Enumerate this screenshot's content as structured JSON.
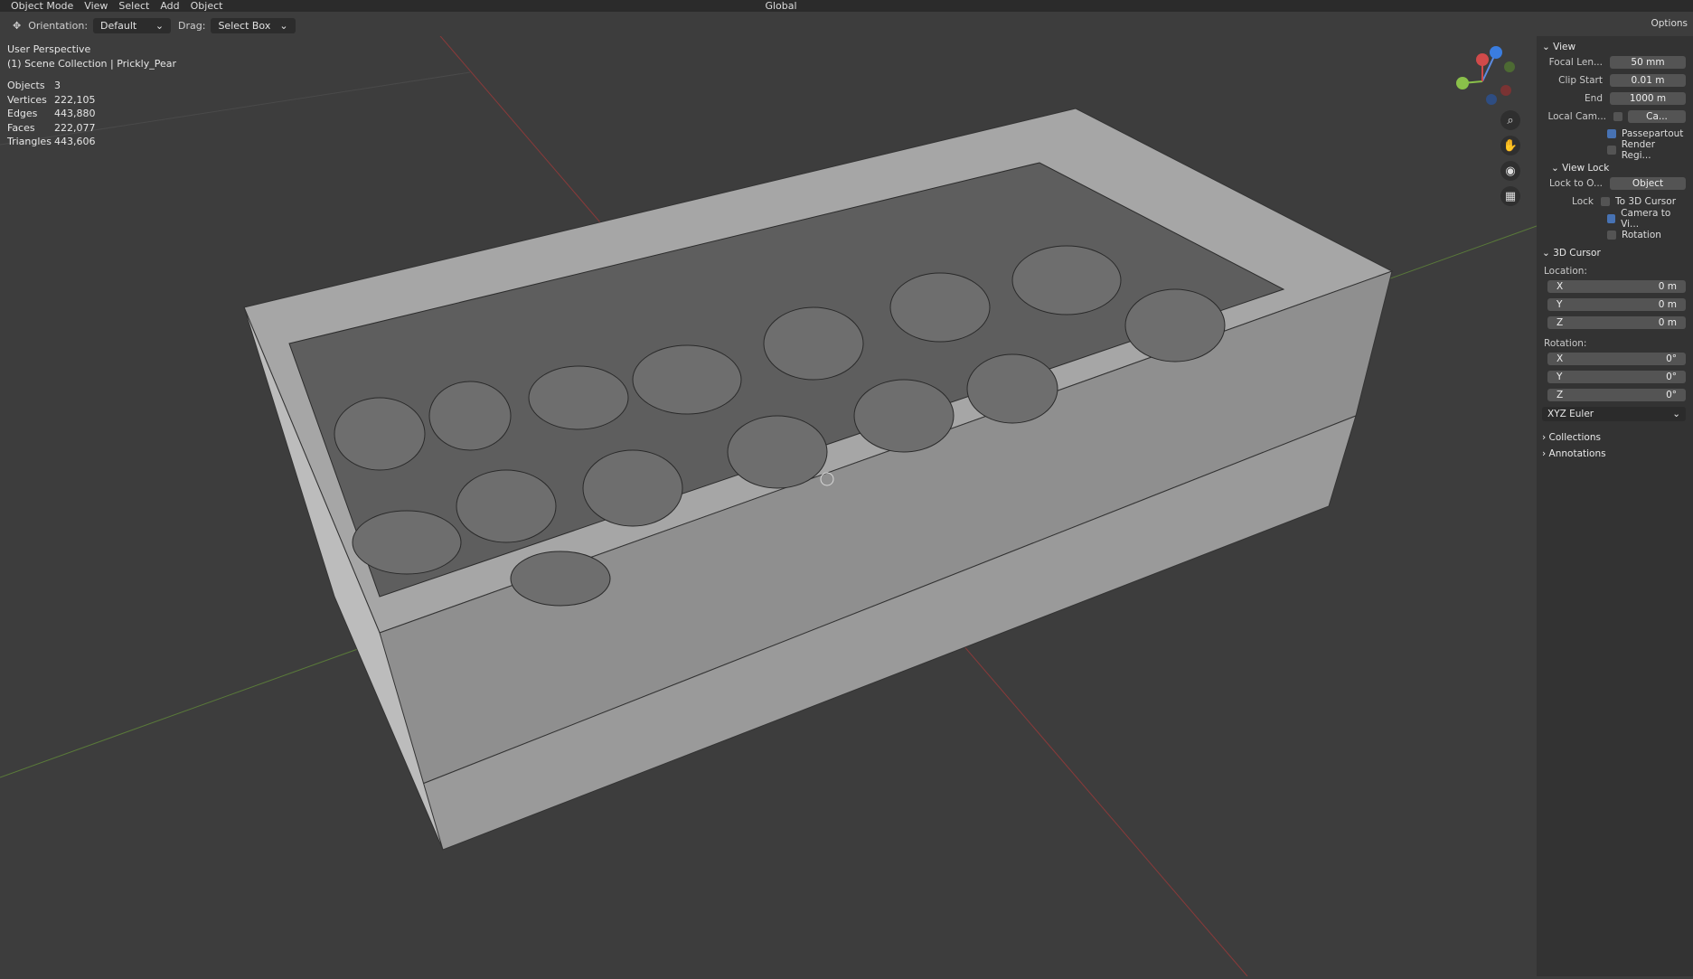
{
  "topbar": {
    "mode": "Object Mode",
    "menu": [
      "View",
      "Select",
      "Add",
      "Object"
    ],
    "transform": "Global"
  },
  "toolbar": {
    "orientation_label": "Orientation:",
    "orientation_value": "Default",
    "drag_label": "Drag:",
    "drag_value": "Select Box"
  },
  "viewport": {
    "perspective": "User Perspective",
    "collection": "(1) Scene Collection | Prickly_Pear",
    "stats": [
      {
        "k": "Objects",
        "v": "3"
      },
      {
        "k": "Vertices",
        "v": "222,105"
      },
      {
        "k": "Edges",
        "v": "443,880"
      },
      {
        "k": "Faces",
        "v": "222,077"
      },
      {
        "k": "Triangles",
        "v": "443,606"
      }
    ]
  },
  "panel": {
    "options": "Options",
    "view": {
      "title": "View",
      "focal_label": "Focal Len...",
      "focal_value": "50 mm",
      "clip_start_label": "Clip Start",
      "clip_start_value": "0.01 m",
      "end_label": "End",
      "end_value": "1000 m",
      "local_cam_label": "Local Cam...",
      "local_cam_value": "Ca...",
      "passepartout": "Passepartout",
      "render_region": "Render Regi..."
    },
    "view_lock": {
      "title": "View Lock",
      "lock_to_label": "Lock to O...",
      "lock_to_value": "Object",
      "lock_label": "Lock",
      "to_cursor": "To 3D Cursor",
      "camera_to_view": "Camera to Vi...",
      "rotation": "Rotation"
    },
    "cursor": {
      "title": "3D Cursor",
      "location_label": "Location:",
      "loc": [
        {
          "a": "X",
          "v": "0 m"
        },
        {
          "a": "Y",
          "v": "0 m"
        },
        {
          "a": "Z",
          "v": "0 m"
        }
      ],
      "rotation_label": "Rotation:",
      "rot": [
        {
          "a": "X",
          "v": "0°"
        },
        {
          "a": "Y",
          "v": "0°"
        },
        {
          "a": "Z",
          "v": "0°"
        }
      ],
      "mode": "XYZ Euler"
    },
    "collections": "Collections",
    "annotations": "Annotations"
  }
}
